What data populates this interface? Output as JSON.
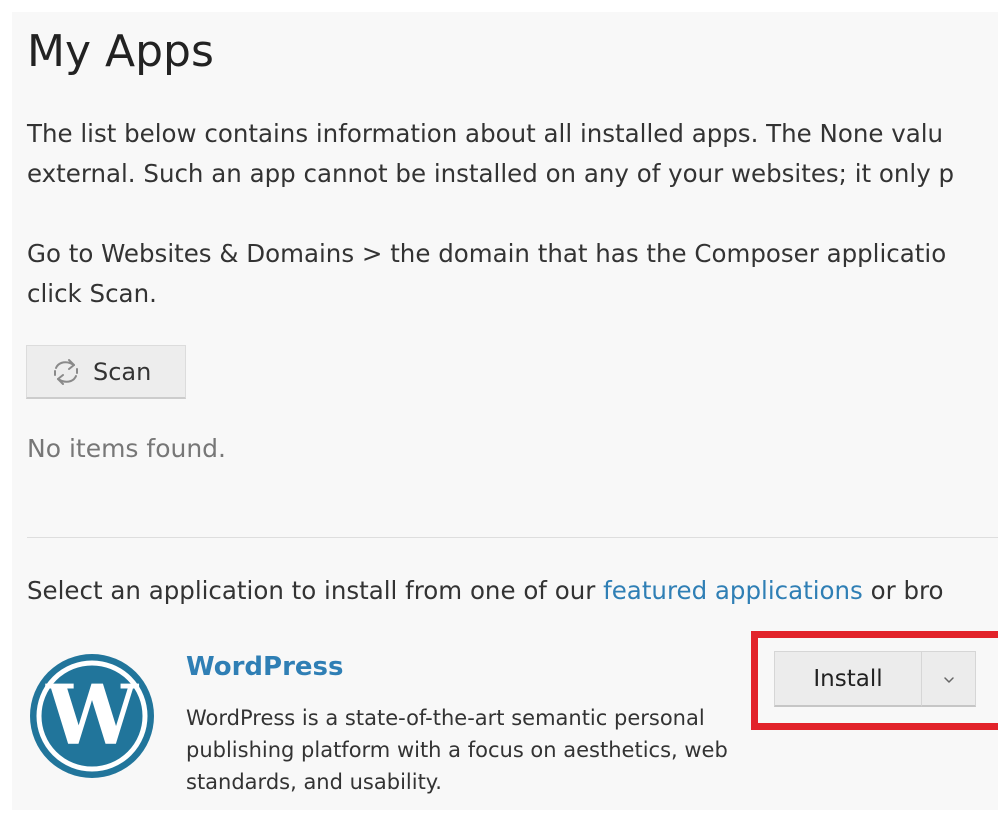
{
  "page": {
    "title": "My Apps",
    "intro_line1": "The list below contains information about all installed apps. The None valu",
    "intro_line2": "external. Such an app cannot be installed on any of your websites; it only p",
    "goto_line1": "Go to Websites & Domains > the domain that has the Composer applicatio",
    "goto_line2": "click Scan."
  },
  "toolbar": {
    "scan_label": "Scan",
    "scan_icon": "refresh-arrows-icon"
  },
  "list": {
    "empty_text": "No items found."
  },
  "install_section": {
    "prefix": "Select an application to install from one of our ",
    "featured_link": "featured applications",
    "suffix": " or bro"
  },
  "app": {
    "name": "WordPress",
    "description": "WordPress is a state-of-the-art semantic personal publishing platform with a focus on aesthetics, web standards, and usability.",
    "logo_icon": "wordpress-logo-icon",
    "install_label": "Install",
    "dropdown_icon": "chevron-down-icon"
  },
  "colors": {
    "link": "#2f7fb5",
    "highlight": "#e2232a",
    "wordpress_blue": "#21759b"
  }
}
